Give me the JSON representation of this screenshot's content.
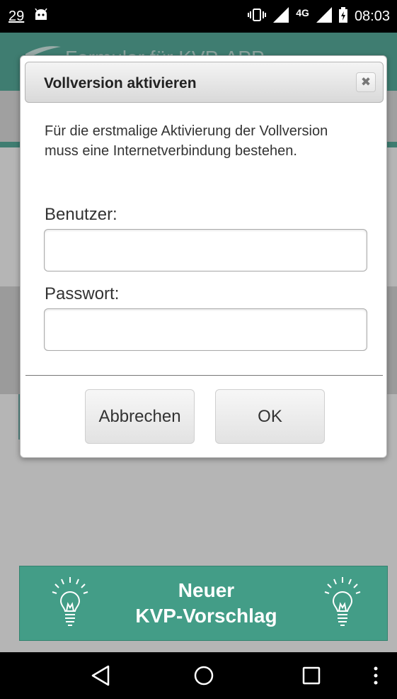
{
  "status_bar": {
    "notification_count": "29",
    "network_type": "4G",
    "time": "08:03",
    "icons": [
      "android-icon",
      "vibrate-icon",
      "signal-icon",
      "signal-icon-2",
      "battery-charging-icon"
    ]
  },
  "app": {
    "title": "Formular für KVP-APP"
  },
  "dialog": {
    "title": "Vollversion aktivieren",
    "info": "Für die erstmalige Aktivierung der Vollversion muss eine Internetverbindung bestehen.",
    "user_label": "Benutzer:",
    "user_value": "",
    "password_label": "Passwort:",
    "password_value": "",
    "cancel_label": "Abbrechen",
    "ok_label": "OK",
    "close_icon": "close-icon"
  },
  "action_button": {
    "line1": "Neuer",
    "line2": "KVP-Vorschlag",
    "icon": "lightbulb-icon"
  },
  "nav_bar": {
    "items": [
      "back-icon",
      "home-icon",
      "recents-icon",
      "overflow-menu-icon"
    ]
  },
  "colors": {
    "accent": "#439d87",
    "appbar": "#55a797",
    "status_bar": "#000000"
  }
}
